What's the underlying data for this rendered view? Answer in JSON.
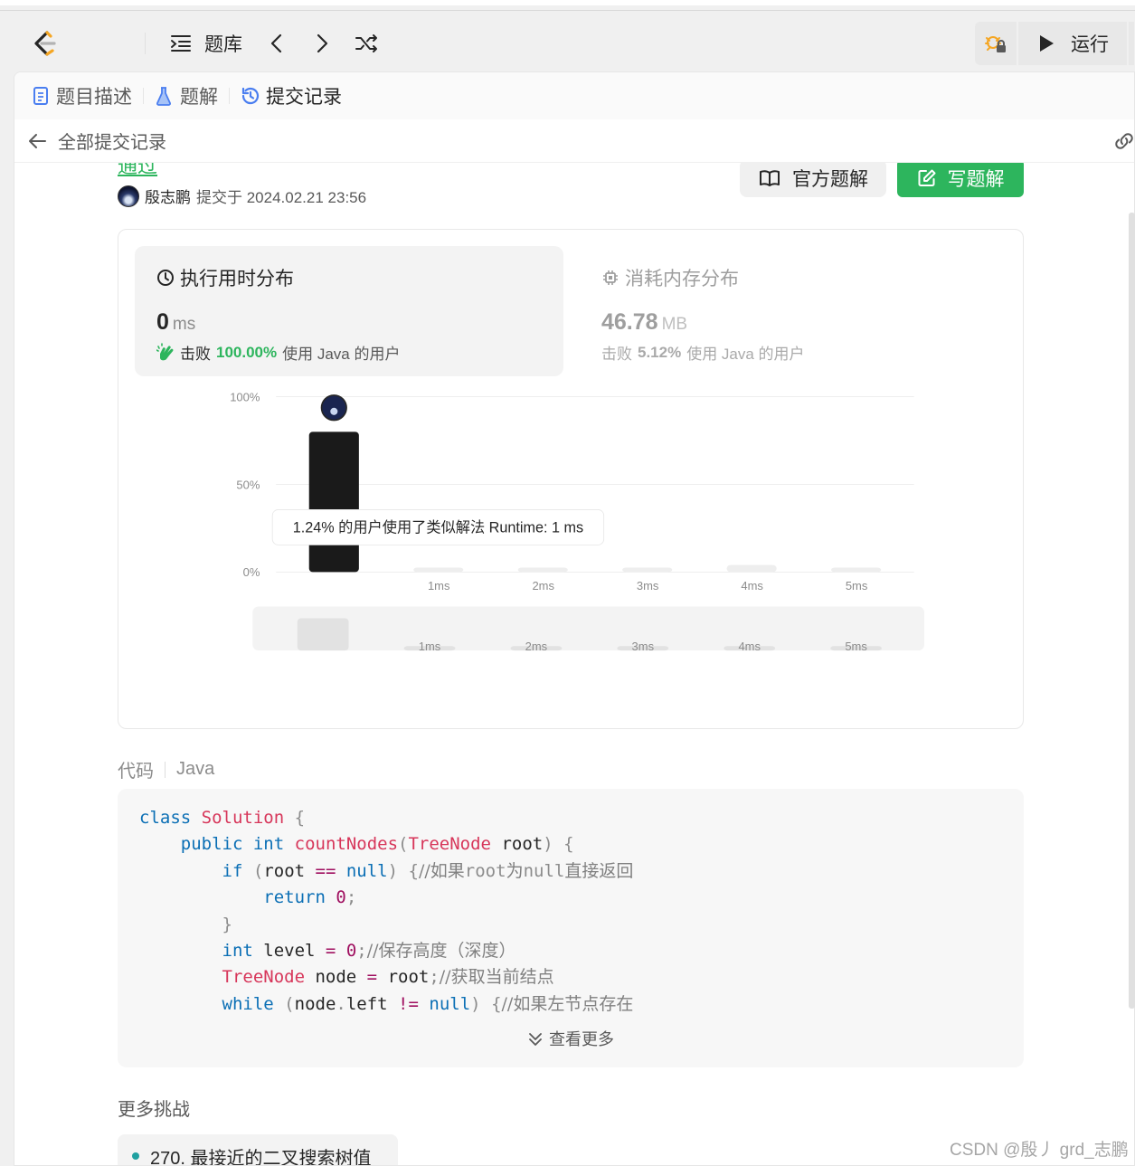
{
  "topbar": {
    "problem_bank": "题库",
    "run": "运行"
  },
  "tabs": {
    "description": "题目描述",
    "solutions": "题解",
    "submissions": "提交记录"
  },
  "subheader": {
    "back_label": "全部提交记录"
  },
  "submission": {
    "status": "通过",
    "author": "殷志鹏",
    "submitted_at": "提交于 2024.02.21 23:56",
    "official_solution": "官方题解",
    "write_solution": "写题解"
  },
  "runtime": {
    "title": "执行用时分布",
    "value": "0",
    "unit": "ms",
    "beats_prefix": "击败",
    "beats_pct": "100.00%",
    "beats_suffix": "使用 Java 的用户"
  },
  "memory": {
    "title": "消耗内存分布",
    "value": "46.78",
    "unit": "MB",
    "beats_prefix": "击败",
    "beats_pct": "5.12%",
    "beats_suffix": "使用 Java 的用户"
  },
  "chart_data": {
    "type": "bar",
    "categories": [
      "0ms",
      "1ms",
      "2ms",
      "3ms",
      "4ms",
      "5ms"
    ],
    "tick_labels": [
      "",
      "1ms",
      "2ms",
      "3ms",
      "4ms",
      "5ms"
    ],
    "values": [
      80,
      1.24,
      1.0,
      1.0,
      4.0,
      1.0
    ],
    "highlight_index": 0,
    "y_ticks": [
      "100%",
      "50%",
      "0%"
    ],
    "ylim": [
      0,
      100
    ],
    "grid": true,
    "tooltip": "1.24% 的用户使用了类似解法 Runtime: 1 ms",
    "overview_values": [
      100,
      10,
      10,
      10,
      10,
      10
    ],
    "overview_labels": [
      "",
      "1ms",
      "2ms",
      "3ms",
      "4ms",
      "5ms"
    ]
  },
  "code": {
    "label": "代码",
    "language": "Java",
    "show_more": "查看更多"
  },
  "more": {
    "title": "更多挑战",
    "items": [
      "270. 最接近的二叉搜索树值"
    ]
  },
  "watermark": "CSDN @殷丿 grd_志鹏",
  "colors": {
    "accent_green": "#2db55d",
    "bar_active": "#1a1a1a",
    "bar_inactive": "#eeeeee"
  }
}
